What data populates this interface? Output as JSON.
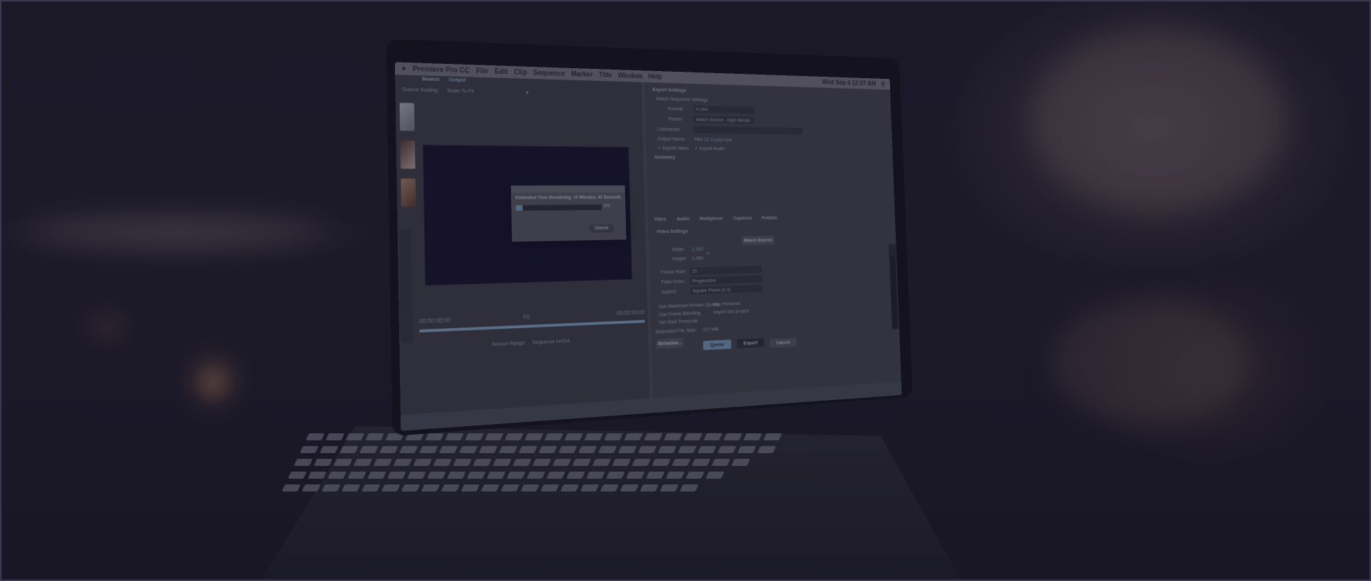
{
  "menubar": {
    "app": "Premiere Pro CC",
    "items": [
      "File",
      "Edit",
      "Clip",
      "Sequence",
      "Marker",
      "Title",
      "Window",
      "Help"
    ],
    "clock": "Wed Sep 4  12:07 AM"
  },
  "source_panel": {
    "tabs": [
      "Source",
      "Output"
    ],
    "source_scaling_label": "Source Scaling:",
    "source_scaling_value": "Scale To Fit",
    "timecode_left": "00:00:00:00",
    "timecode_right": "00:00:00:00",
    "fit_label": "Fit",
    "source_range_label": "Source Range:",
    "source_range_value": "Sequence In/Out"
  },
  "export_settings": {
    "header": "Export Settings",
    "match_sequence": "Match Sequence Settings",
    "format_label": "Format:",
    "format_value": "H.264",
    "preset_label": "Preset:",
    "preset_value": "Match Source - High Bitrate",
    "comments_label": "Comments:",
    "output_name_label": "Output Name:",
    "output_name_value": "Film 12-3 (ua).mp4",
    "export_video": "Export Video",
    "export_audio": "Export Audio",
    "summary_label": "Summary"
  },
  "settings_tabs": [
    "Video",
    "Audio",
    "Multiplexer",
    "Captions",
    "Publish"
  ],
  "video_settings": {
    "header": "Video Settings",
    "match_source_button": "Match Source",
    "width_label": "Width:",
    "width_value": "1,920",
    "height_label": "Height:",
    "height_value": "1,080",
    "frame_rate_label": "Frame Rate:",
    "frame_rate_value": "25",
    "field_order_label": "Field Order:",
    "field_order_value": "Progressive",
    "aspect_label": "Aspect:",
    "aspect_value": "Square Pixels (1.0)"
  },
  "render_options": {
    "max_render_quality": "Use Maximum Render Quality",
    "use_previews": "Use Previews",
    "frame_blending": "Use Frame Blending",
    "import_into_project": "Import into project",
    "start_timecode": "Set Start Timecode",
    "estimated_size_label": "Estimated File Size:",
    "estimated_size_value": "227 MB"
  },
  "footer_buttons": {
    "metadata": "Metadata...",
    "queue": "Queue",
    "export": "Export",
    "cancel": "Cancel"
  },
  "encoding_dialog": {
    "estimated_time": "Estimated Time Remaining: 10 Minutes, 43 Seconds",
    "progress_percent": 8,
    "progress_label": "8%",
    "cancel": "Cancel"
  },
  "colors": {
    "overlay": "#1c1a30",
    "accent_blue": "#8fbfd6",
    "video_black": "#0f0b26"
  }
}
